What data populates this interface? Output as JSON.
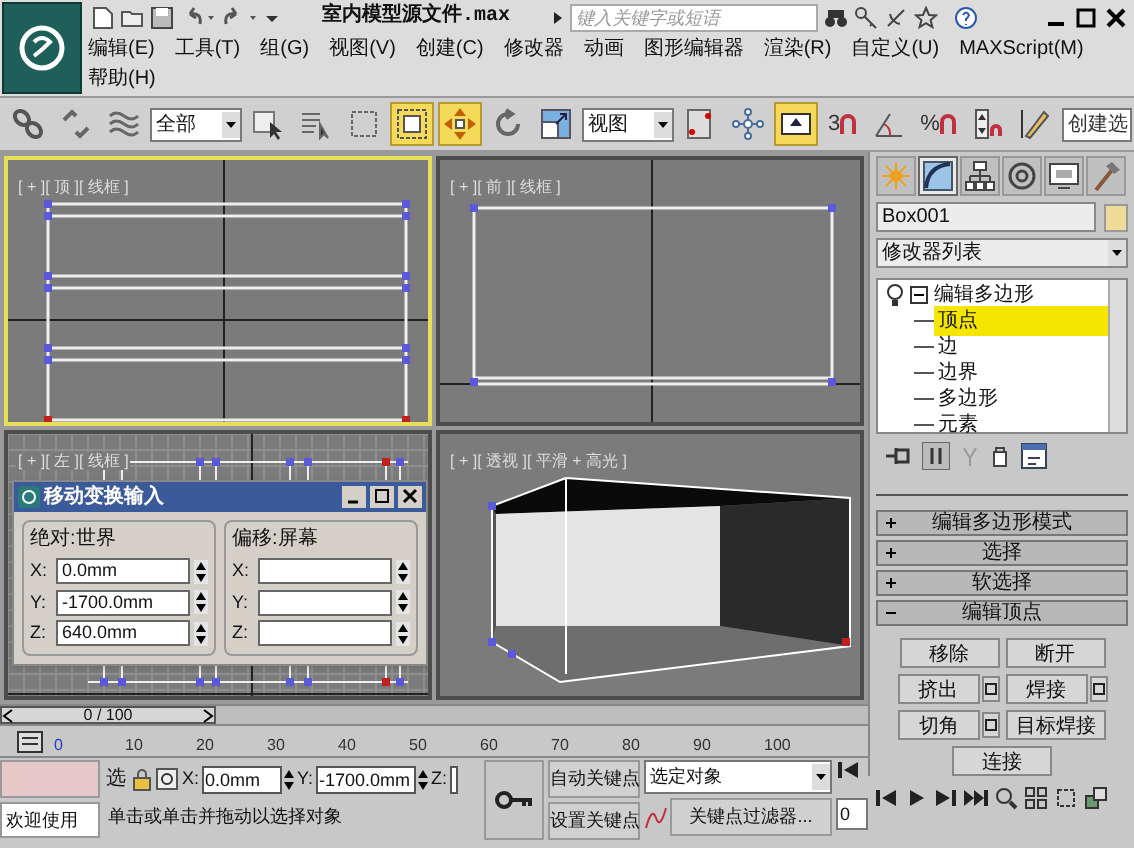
{
  "title_bar": {
    "title": "室内模型源文件.max",
    "search": {
      "placeholder": "键入关键字或短语"
    }
  },
  "menu": [
    "编辑(E)",
    "工具(T)",
    "组(G)",
    "视图(V)",
    "创建(C)",
    "修改器",
    "动画",
    "图形编辑器",
    "渲染(R)",
    "自定义(U)",
    "MAXScript(M)",
    "帮助(H)"
  ],
  "toolbar": [
    {
      "kind": "link",
      "selected": false
    },
    {
      "kind": "unlink",
      "selected": false
    },
    {
      "kind": "bind",
      "selected": false
    },
    {
      "kind": "dropdown",
      "value": "全部"
    },
    {
      "kind": "select",
      "selected": false
    },
    {
      "kind": "select-by-name",
      "selected": false
    },
    {
      "kind": "region",
      "selected": false
    },
    {
      "kind": "window-crossing",
      "selected": true
    },
    {
      "kind": "move",
      "selected": true
    },
    {
      "kind": "rotate",
      "selected": false
    },
    {
      "kind": "scale",
      "selected": false
    },
    {
      "kind": "dropdown",
      "value": "视图"
    },
    {
      "kind": "pivot",
      "selected": false
    },
    {
      "kind": "manipulate",
      "selected": false
    },
    {
      "kind": "keyboard",
      "selected": true
    },
    {
      "kind": "snap",
      "label": "3",
      "selected": false
    },
    {
      "kind": "angle-snap",
      "selected": false
    },
    {
      "kind": "percent-snap",
      "label": "%",
      "selected": false
    },
    {
      "kind": "spinner-snap",
      "selected": false
    },
    {
      "kind": "edit-named",
      "selected": false
    },
    {
      "kind": "field",
      "value": "创建选"
    }
  ],
  "viewports": [
    {
      "kind": "top",
      "label": "[ + ][ 顶 ][ 线框 ]",
      "selected": true
    },
    {
      "kind": "front",
      "label": "[ + ][ 前 ][ 线框 ]",
      "selected": false
    },
    {
      "kind": "left",
      "label": "[ + ][ 左 ][ 线框 ]",
      "selected": false
    },
    {
      "kind": "perspective",
      "label": "[ + ][ 透视 ][ 平滑 + 高光 ]",
      "selected": false
    }
  ],
  "dialog": {
    "title": "移动变换输入",
    "groups": [
      {
        "title": "绝对:世界",
        "fields": [
          {
            "label": "X:",
            "value": "0.0mm"
          },
          {
            "label": "Y:",
            "value": "-1700.0mm"
          },
          {
            "label": "Z:",
            "value": "640.0mm"
          }
        ]
      },
      {
        "title": "偏移:屏幕",
        "fields": [
          {
            "label": "X:"
          },
          {
            "label": "Y:"
          },
          {
            "label": "Z:"
          }
        ]
      }
    ]
  },
  "timeline": {
    "frame": "0 / 100",
    "level": 0,
    "ruler": [
      "0",
      "10",
      "20",
      "30",
      "40",
      "50",
      "60",
      "70",
      "80",
      "90",
      "100"
    ]
  },
  "command_panel": {
    "tabs": [
      {
        "kind": "create",
        "selected": false
      },
      {
        "kind": "modify",
        "selected": true
      },
      {
        "kind": "hierarchy",
        "selected": false
      },
      {
        "kind": "motion",
        "selected": false
      },
      {
        "kind": "display",
        "selected": false
      },
      {
        "kind": "utilities",
        "selected": false
      }
    ],
    "object_name": "Box001",
    "modifier_list": "修改器列表",
    "stack": [
      {
        "label": "编辑多边形",
        "expanded": true,
        "children": [
          {
            "label": "顶点",
            "selected": true
          },
          {
            "label": "边",
            "selected": false
          },
          {
            "label": "边界",
            "selected": false
          },
          {
            "label": "多边形",
            "selected": false
          },
          {
            "label": "元素",
            "selected": false
          }
        ]
      }
    ],
    "rollouts": [
      {
        "title": "编辑多边形模式",
        "expanded": false
      },
      {
        "title": "选择",
        "expanded": false
      },
      {
        "title": "软选择",
        "expanded": false
      },
      {
        "title": "编辑顶点",
        "expanded": true
      }
    ],
    "vertex_buttons": [
      [
        {
          "label": "移除",
          "settings": false
        },
        {
          "label": "断开",
          "settings": false
        }
      ],
      [
        {
          "label": "挤出",
          "settings": true
        },
        {
          "label": "焊接",
          "settings": true
        }
      ],
      [
        {
          "label": "切角",
          "settings": true
        },
        {
          "label": "目标焊接",
          "settings": false
        }
      ],
      [
        {
          "label": "连接",
          "settings": false
        }
      ]
    ]
  },
  "status_bar": {
    "welcome": "欢迎使用",
    "selection_lock": "选",
    "coords": [
      {
        "label": "X:",
        "value": "0.0mm"
      },
      {
        "label": "Y:",
        "value": "-1700.0mm"
      },
      {
        "label": "Z:"
      }
    ],
    "prompt": "单击或单击并拖动以选择对象",
    "auto_key": "自动关键点",
    "set_key": "设置关键点",
    "key_mode": "选定对象",
    "key_filters": "关键点过滤器...",
    "frame": "0"
  }
}
